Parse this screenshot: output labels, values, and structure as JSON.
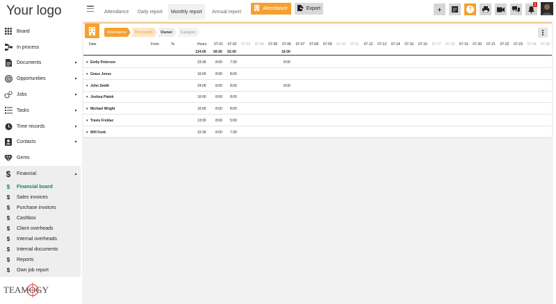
{
  "app": {
    "logo": "Your logo",
    "brand": "TEAMOGY"
  },
  "sidebar": {
    "items": [
      {
        "label": "Board",
        "icon": "grid-icon",
        "caret": ""
      },
      {
        "label": "In process",
        "icon": "flow-icon",
        "caret": ""
      },
      {
        "label": "Documents",
        "icon": "document-icon",
        "caret": "▾"
      },
      {
        "label": "Opportunities",
        "icon": "target-icon",
        "caret": "▾"
      },
      {
        "label": "Jobs",
        "icon": "gears-icon",
        "caret": "▾"
      },
      {
        "label": "Tasks",
        "icon": "tasks-icon",
        "caret": "▾"
      },
      {
        "label": "Time records",
        "icon": "clock-icon",
        "caret": "▾"
      },
      {
        "label": "Contacts",
        "icon": "contacts-icon",
        "caret": "▾"
      },
      {
        "label": "Gems",
        "icon": "gem-icon",
        "caret": ""
      },
      {
        "label": "Financial",
        "icon": "dollar-icon",
        "caret": "▴"
      }
    ],
    "financial_sub": [
      "Financial board",
      "Sales invoices",
      "Purchase invoices",
      "Cashbox",
      "Client overheads",
      "Internal overheads",
      "Internal documents",
      "Reports",
      "Own job report"
    ]
  },
  "topbar": {
    "tabs": [
      "Attendance",
      "Daily report",
      "Monthly report",
      "Annual report"
    ],
    "selected_tab": "Monthly report",
    "attendance_button": "Attendance",
    "export_button": "Export",
    "help": "?",
    "notification_count": "1"
  },
  "breadcrumbs": [
    "Attendance",
    "This month",
    "Owner",
    "Category"
  ],
  "table": {
    "headers": {
      "date": "Date",
      "from": "From",
      "to": "To",
      "hours": "Hours"
    },
    "days": [
      "07-01",
      "07-02",
      "07-03",
      "07-04",
      "07-05",
      "07-06",
      "07-07",
      "07-08",
      "07-09",
      "07-10",
      "07-11",
      "07-12",
      "07-13",
      "07-14",
      "07-15",
      "07-16",
      "07-17",
      "07-18",
      "07-19",
      "07-20",
      "07-21",
      "07-22",
      "07-23",
      "07-24",
      "07-25"
    ],
    "weekend_days": [
      "07-03",
      "07-04",
      "07-10",
      "07-11",
      "07-17",
      "07-18",
      "07-24",
      "07-25"
    ],
    "totals": {
      "hours": "124:00",
      "07-01": "56:00",
      "07-02": "52:00",
      "07-06": "16:00"
    },
    "rows": [
      {
        "name": "Emily Peterson",
        "hours": "23:30",
        "d1": "8:00",
        "d2": "7:30",
        "d6": "8:00"
      },
      {
        "name": "Grace Jones",
        "hours": "16:00",
        "d1": "8:00",
        "d2": "8:00",
        "d6": ""
      },
      {
        "name": "John Smith",
        "hours": "24:00",
        "d1": "8:00",
        "d2": "8:00",
        "d6": "8:00"
      },
      {
        "name": "Joshua Piatek",
        "hours": "16:00",
        "d1": "8:00",
        "d2": "8:00",
        "d6": ""
      },
      {
        "name": "Michael Wright",
        "hours": "16:00",
        "d1": "8:00",
        "d2": "8:00",
        "d6": ""
      },
      {
        "name": "Travis Freklaz",
        "hours": "13:00",
        "d1": "8:00",
        "d2": "5:00",
        "d6": ""
      },
      {
        "name": "Will Funk",
        "hours": "15:30",
        "d1": "8:00",
        "d2": "7:30",
        "d6": ""
      }
    ]
  },
  "colors": {
    "accent": "#f6a030",
    "active_sub": "#1a7a70"
  }
}
